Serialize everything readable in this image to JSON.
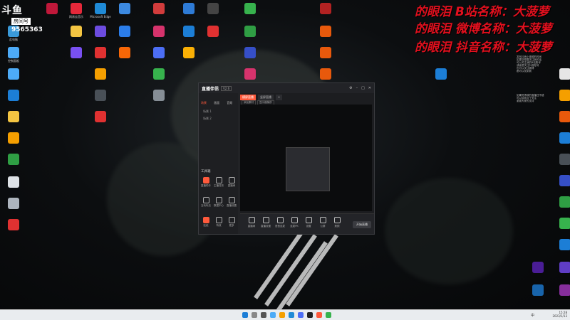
{
  "overlay": {
    "platform": "斗鱼",
    "room_label": "房间号",
    "room_id": "9565363",
    "banners": [
      "的眼泪   B站名称：大菠萝",
      "的眼泪  微博名称：大菠萝",
      "的眼泪  抖音名称：大菠萝"
    ]
  },
  "desktop_icons": [
    {
      "label": "回收站",
      "color": "#7c8a96"
    },
    {
      "label": "",
      "color": "#c0183a"
    },
    {
      "label": "网易云音乐",
      "color": "#e5283a"
    },
    {
      "label": "Microsoft Edge",
      "color": "#1f8ad6"
    },
    {
      "label": "",
      "color": "#3c89e0"
    },
    {
      "label": "",
      "color": "#d23c3c"
    },
    {
      "label": "",
      "color": "#2e7bd6"
    },
    {
      "label": "",
      "color": "#444"
    },
    {
      "label": "",
      "color": "#37b24d"
    },
    {
      "label": "",
      "color": "#b22222"
    },
    {
      "label": "此电脑",
      "color": "#3a9ad9"
    },
    {
      "label": "",
      "color": "#f4c542"
    },
    {
      "label": "",
      "color": "#6c4ce0"
    },
    {
      "label": "",
      "color": "#2b7de9"
    },
    {
      "label": "",
      "color": "#d6336c"
    },
    {
      "label": "",
      "color": "#1c7ed6"
    },
    {
      "label": "",
      "color": "#e03131"
    },
    {
      "label": "",
      "color": "#2f9e44"
    },
    {
      "label": "",
      "color": "#e8590c"
    },
    {
      "label": "控制面板",
      "color": "#4dabf7"
    },
    {
      "label": "",
      "color": "#7950f2"
    },
    {
      "label": "",
      "color": "#e03131"
    },
    {
      "label": "",
      "color": "#f76707"
    },
    {
      "label": "",
      "color": "#4c6ef5"
    },
    {
      "label": "",
      "color": "#fab005"
    },
    {
      "label": "",
      "color": "#364fc7"
    }
  ],
  "banner_desktop_icons": [
    "icon-a",
    "icon-b"
  ],
  "stream_window": {
    "brand": "直播伴侣",
    "version": "V2.6",
    "side_tabs": [
      "场景",
      "画面",
      "音频"
    ],
    "scene_rows": [
      "场景 1",
      "场景 2"
    ],
    "tool_header": "工具箱",
    "tools": [
      "直播助手",
      "主播任务",
      "直播间",
      "互动玩法",
      "数据中心",
      "直播设置",
      "贴纸",
      "特效",
      "更多"
    ],
    "preview_tabs": [
      "横屏直播",
      "竖屏直播",
      "+"
    ],
    "preview_buttons": [
      "添加素材",
      "显示器捕获"
    ],
    "bottom_tools": [
      "直播间",
      "直播设置",
      "语音连麦",
      "连麦PK",
      "设置",
      "公屏",
      "美颜"
    ],
    "start_label": "开始直播"
  },
  "right_text_top": [
    "发布抖音小视频的时间",
    "如果您想要关注我的话",
    "可以关注我的B站账号",
    "或者是关注抖音账号",
    "也可以关注微博",
    "都可以找到我"
  ],
  "right_text_mid": [
    "如果觉得我的直播还不错",
    "可以给我点个关注",
    "谢谢大家的支持"
  ],
  "taskbar": {
    "time": "15:28",
    "date": "2023/1/13",
    "lang": "中"
  },
  "colors": {
    "accent": "#ff5a3c",
    "banner": "#e3101e",
    "taskbar": "#e9ecef"
  }
}
